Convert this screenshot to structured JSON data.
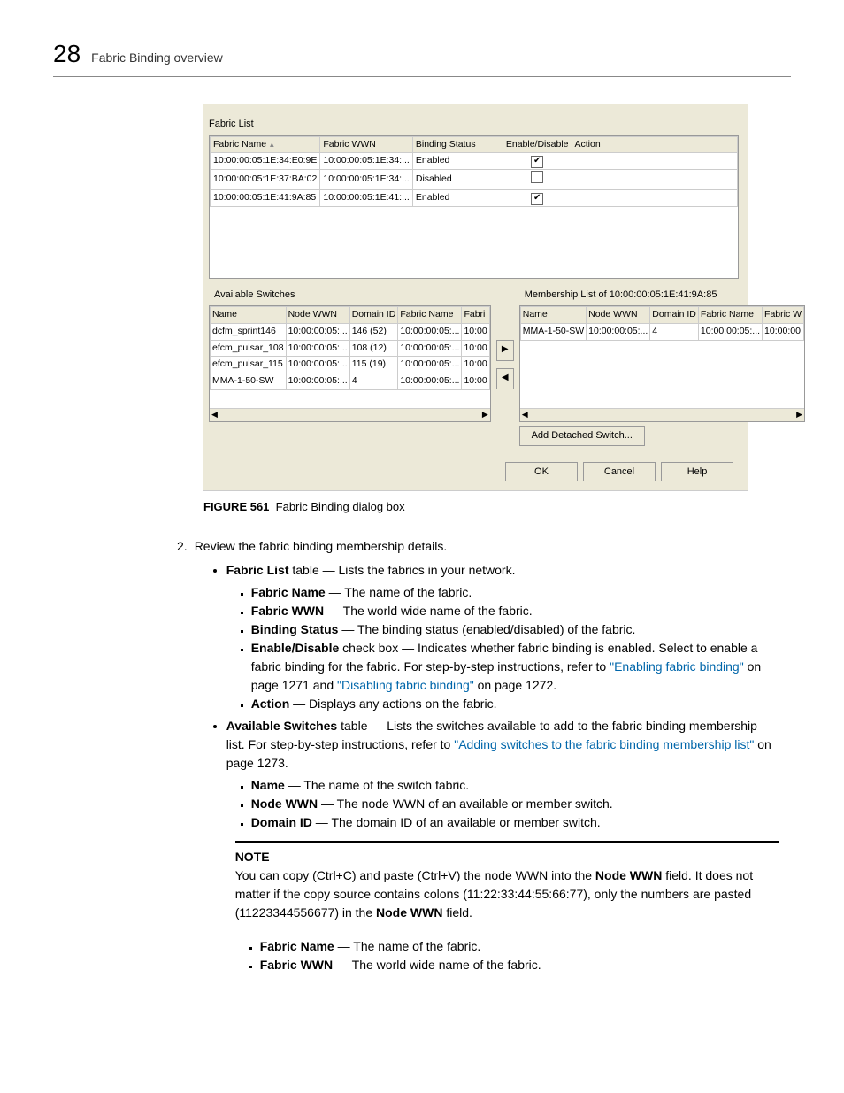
{
  "header": {
    "page_number": "28",
    "title": "Fabric Binding overview"
  },
  "dialog": {
    "fabric_list_label": "Fabric List",
    "fabric_list_cols": [
      "Fabric Name",
      "Fabric WWN",
      "Binding Status",
      "Enable/Disable",
      "Action"
    ],
    "fabric_list_rows": [
      {
        "name": "10:00:00:05:1E:34:E0:9E",
        "wwn": "10:00:00:05:1E:34:...",
        "status": "Enabled",
        "checked": true
      },
      {
        "name": "10:00:00:05:1E:37:BA:02",
        "wwn": "10:00:00:05:1E:34:...",
        "status": "Disabled",
        "checked": false
      },
      {
        "name": "10:00:00:05:1E:41:9A:85",
        "wwn": "10:00:00:05:1E:41:...",
        "status": "Enabled",
        "checked": true
      }
    ],
    "avail_label": "Available Switches",
    "avail_cols": [
      "Name",
      "Node WWN",
      "Domain ID",
      "Fabric Name",
      "Fabri"
    ],
    "avail_rows": [
      {
        "c": [
          "dcfm_sprint146",
          "10:00:00:05:...",
          "146 (52)",
          "10:00:00:05:...",
          "10:00"
        ]
      },
      {
        "c": [
          "efcm_pulsar_108",
          "10:00:00:05:...",
          "108 (12)",
          "10:00:00:05:...",
          "10:00"
        ]
      },
      {
        "c": [
          "efcm_pulsar_115",
          "10:00:00:05:...",
          "115 (19)",
          "10:00:00:05:...",
          "10:00"
        ]
      },
      {
        "c": [
          "MMA-1-50-SW",
          "10:00:00:05:...",
          "4",
          "10:00:00:05:...",
          "10:00"
        ]
      }
    ],
    "member_label": "Membership List of 10:00:00:05:1E:41:9A:85",
    "member_cols": [
      "Name",
      "Node WWN",
      "Domain ID",
      "Fabric Name",
      "Fabric W"
    ],
    "member_rows": [
      {
        "c": [
          "MMA-1-50-SW",
          "10:00:00:05:...",
          "4",
          "10:00:00:05:...",
          "10:00:00"
        ]
      }
    ],
    "add_detached": "Add Detached Switch...",
    "ok": "OK",
    "cancel": "Cancel",
    "help": "Help"
  },
  "figure": {
    "label": "FIGURE 561",
    "text": "Fabric Binding dialog box"
  },
  "step": {
    "num": "2.",
    "text": "Review the fabric binding membership details.",
    "fabric_list_intro_a": "Fabric List",
    "fabric_list_intro_b": " table — Lists the fabrics in your network.",
    "fname_a": "Fabric Name",
    "fname_b": " — The name of the fabric.",
    "fwwn_a": "Fabric WWN",
    "fwwn_b": " — The world wide name of the fabric.",
    "bstat_a": "Binding Status",
    "bstat_b": " — The binding status (enabled/disabled) of the fabric.",
    "enab_a": "Enable/Disable",
    "enab_b": " check box — Indicates whether fabric binding is enabled. Select to enable a fabric binding for the fabric. For step-by-step instructions, refer to ",
    "enab_link1": "\"Enabling fabric binding\"",
    "enab_c": " on page 1271 and ",
    "enab_link2": "\"Disabling fabric binding\"",
    "enab_d": " on page 1272.",
    "action_a": "Action",
    "action_b": " — Displays any actions on the fabric.",
    "avail_a": "Available Switches",
    "avail_b": " table — Lists the switches available to add to the fabric binding membership list. For step-by-step instructions, refer to ",
    "avail_link": "\"Adding switches to the fabric binding membership list\"",
    "avail_c": " on page 1273.",
    "name_a": "Name",
    "name_b": " — The name of the switch fabric.",
    "nwwn_a": "Node WWN",
    "nwwn_b": " — The node WWN of an available or member switch.",
    "did_a": "Domain ID",
    "did_b": " — The domain ID of an available or member switch.",
    "note_label": "NOTE",
    "note_a": "You can copy (Ctrl+C) and paste (Ctrl+V) the node WWN into the ",
    "note_bold1": "Node WWN",
    "note_b": " field. It does not matter if the copy source contains colons (11:22:33:44:55:66:77), only the numbers are pasted (11223344556677) in the ",
    "note_bold2": "Node WWN",
    "note_c": " field.",
    "fname2_a": "Fabric Name",
    "fname2_b": " — The name of the fabric.",
    "fwwn2_a": "Fabric WWN",
    "fwwn2_b": " — The world wide name of the fabric."
  }
}
